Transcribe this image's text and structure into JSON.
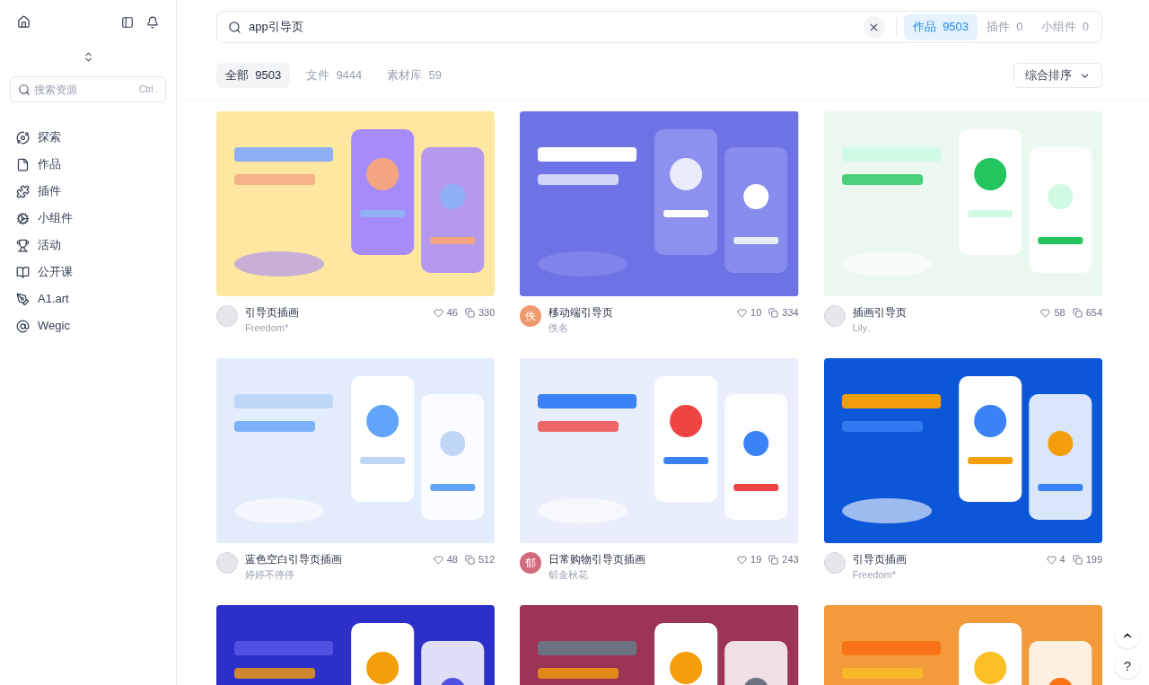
{
  "sidebar": {
    "search_placeholder": "搜索资源",
    "search_shortcut": "Ctrl .",
    "items": [
      {
        "label": "探索"
      },
      {
        "label": "作品"
      },
      {
        "label": "插件"
      },
      {
        "label": "小组件"
      },
      {
        "label": "活动"
      },
      {
        "label": "公开课"
      },
      {
        "label": "A1.art"
      },
      {
        "label": "Wegic"
      }
    ]
  },
  "search": {
    "value": "app引导页"
  },
  "scopes": [
    {
      "label": "作品",
      "count": "9503",
      "selected": true
    },
    {
      "label": "插件",
      "count": "0",
      "selected": false
    },
    {
      "label": "小组件",
      "count": "0",
      "selected": false
    }
  ],
  "filters": [
    {
      "label": "全部",
      "count": "9503",
      "selected": true
    },
    {
      "label": "文件",
      "count": "9444",
      "selected": false
    },
    {
      "label": "素材库",
      "count": "59",
      "selected": false
    }
  ],
  "sort": "综合排序",
  "cards": [
    {
      "kind": "full",
      "title": "引导页插画",
      "author": "Freedom*",
      "likes": "46",
      "copies": "330",
      "avatar": {
        "kind": "picture"
      }
    },
    {
      "kind": "full",
      "title": "移动端引导页",
      "author": "佚名",
      "likes": "10",
      "copies": "334",
      "avatar": {
        "kind": "letter",
        "letter": "佚",
        "color": "#ee9a6c"
      }
    },
    {
      "kind": "full",
      "title": "插画引导页",
      "author": "Lily、",
      "likes": "58",
      "copies": "654",
      "avatar": {
        "kind": "picture"
      }
    },
    {
      "kind": "full",
      "title": "蓝色空白引导页插画",
      "author": "婷婷不停停",
      "likes": "48",
      "copies": "512",
      "avatar": {
        "kind": "picture"
      }
    },
    {
      "kind": "full",
      "title": "日常购物引导页插画",
      "author": "郁金秋花",
      "likes": "19",
      "copies": "243",
      "avatar": {
        "kind": "letter",
        "letter": "郁",
        "color": "#d06a7c"
      }
    },
    {
      "kind": "full",
      "title": "引导页插画",
      "author": "Freedom*",
      "likes": "4",
      "copies": "199",
      "avatar": {
        "kind": "picture"
      }
    },
    {
      "kind": "picture"
    },
    {
      "kind": "picture"
    },
    {
      "kind": "picture"
    }
  ],
  "help": "?"
}
